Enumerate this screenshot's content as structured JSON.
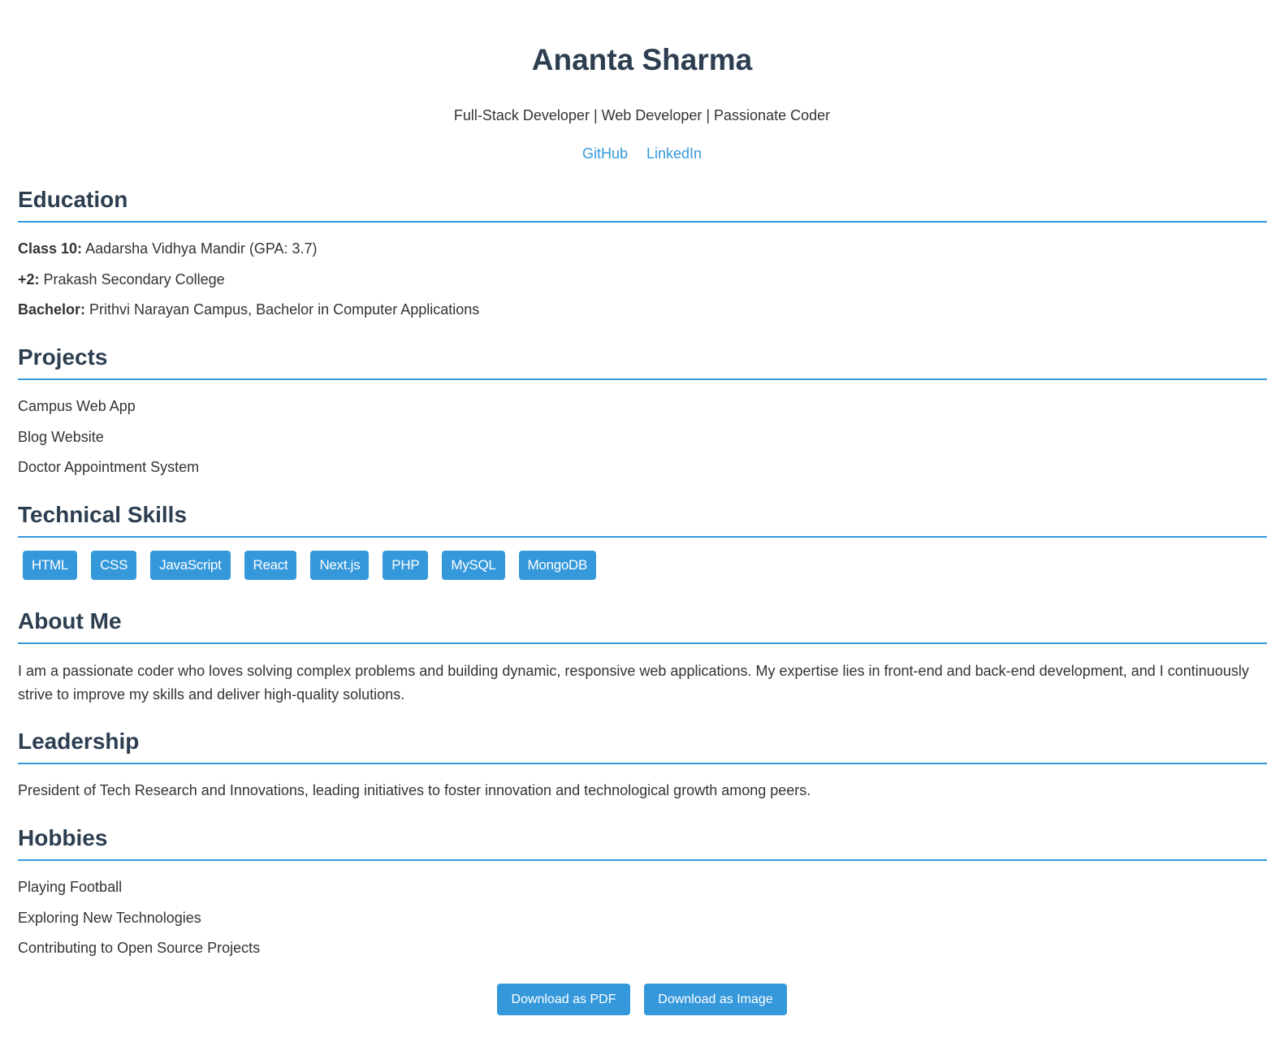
{
  "header": {
    "name": "Ananta Sharma",
    "tagline": "Full-Stack Developer | Web Developer | Passionate Coder",
    "links": [
      {
        "label": "GitHub"
      },
      {
        "label": "LinkedIn"
      }
    ]
  },
  "education": {
    "title": "Education",
    "items": [
      {
        "label": "Class 10:",
        "value": " Aadarsha Vidhya Mandir (GPA: 3.7)"
      },
      {
        "label": "+2:",
        "value": " Prakash Secondary College"
      },
      {
        "label": "Bachelor:",
        "value": " Prithvi Narayan Campus, Bachelor in Computer Applications"
      }
    ]
  },
  "projects": {
    "title": "Projects",
    "items": [
      "Campus Web App",
      "Blog Website",
      "Doctor Appointment System"
    ]
  },
  "skills": {
    "title": "Technical Skills",
    "items": [
      "HTML",
      "CSS",
      "JavaScript",
      "React",
      "Next.js",
      "PHP",
      "MySQL",
      "MongoDB"
    ]
  },
  "about": {
    "title": "About Me",
    "text": "I am a passionate coder who loves solving complex problems and building dynamic, responsive web applications. My expertise lies in front-end and back-end development, and I continuously strive to improve my skills and deliver high-quality solutions."
  },
  "leadership": {
    "title": "Leadership",
    "text": "President of Tech Research and Innovations, leading initiatives to foster innovation and technological growth among peers."
  },
  "hobbies": {
    "title": "Hobbies",
    "items": [
      "Playing Football",
      "Exploring New Technologies",
      "Contributing to Open Source Projects"
    ]
  },
  "actions": {
    "pdf_label": "Download as PDF",
    "image_label": "Download as Image"
  },
  "colors": {
    "accent": "#3498db",
    "heading": "#2c3e50",
    "text": "#333333"
  }
}
